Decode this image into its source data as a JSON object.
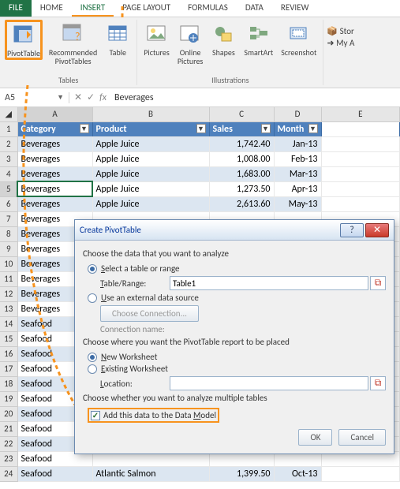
{
  "tabs": {
    "file": "FILE",
    "home": "HOME",
    "insert": "INSERT",
    "page_layout": "PAGE LAYOUT",
    "formulas": "FORMULAS",
    "data": "DATA",
    "review": "REVIEW"
  },
  "ribbon": {
    "pivottable": "PivotTable",
    "recommended": "Recommended\nPivotTables",
    "table": "Table",
    "pictures": "Pictures",
    "online_pictures": "Online\nPictures",
    "shapes": "Shapes",
    "smartart": "SmartArt",
    "screenshot": "Screenshot",
    "group_tables": "Tables",
    "group_illustrations": "Illustrations"
  },
  "account": {
    "stor": "Stor",
    "my": "My A"
  },
  "formula_bar": {
    "name_box": "A5",
    "fx_value": "Beverages"
  },
  "columns": [
    "A",
    "B",
    "C",
    "D",
    "E"
  ],
  "table_headers": {
    "category": "Category",
    "product": "Product",
    "sales": "Sales",
    "month": "Month"
  },
  "rows": [
    {
      "n": 2,
      "cat": "Beverages",
      "prod": "Apple Juice",
      "sales": "1,742.40",
      "month": "Jan-13"
    },
    {
      "n": 3,
      "cat": "Beverages",
      "prod": "Apple Juice",
      "sales": "1,008.00",
      "month": "Feb-13"
    },
    {
      "n": 4,
      "cat": "Beverages",
      "prod": "Apple Juice",
      "sales": "1,683.00",
      "month": "Mar-13"
    },
    {
      "n": 5,
      "cat": "Beverages",
      "prod": "Apple Juice",
      "sales": "1,273.50",
      "month": "Apr-13"
    },
    {
      "n": 6,
      "cat": "Beverages",
      "prod": "Apple Juice",
      "sales": "2,613.60",
      "month": "May-13"
    },
    {
      "n": 7,
      "cat": "Beverages",
      "prod": "",
      "sales": "",
      "month": ""
    },
    {
      "n": 8,
      "cat": "Beverages",
      "prod": "",
      "sales": "",
      "month": ""
    },
    {
      "n": 9,
      "cat": "Beverages",
      "prod": "",
      "sales": "",
      "month": ""
    },
    {
      "n": 10,
      "cat": "Beverages",
      "prod": "",
      "sales": "",
      "month": ""
    },
    {
      "n": 11,
      "cat": "Beverages",
      "prod": "",
      "sales": "",
      "month": ""
    },
    {
      "n": 12,
      "cat": "Beverages",
      "prod": "",
      "sales": "",
      "month": ""
    },
    {
      "n": 13,
      "cat": "Beverages",
      "prod": "",
      "sales": "",
      "month": ""
    },
    {
      "n": 14,
      "cat": "Seafood",
      "prod": "",
      "sales": "",
      "month": ""
    },
    {
      "n": 15,
      "cat": "Seafood",
      "prod": "",
      "sales": "",
      "month": ""
    },
    {
      "n": 16,
      "cat": "Seafood",
      "prod": "",
      "sales": "",
      "month": ""
    },
    {
      "n": 17,
      "cat": "Seafood",
      "prod": "",
      "sales": "",
      "month": ""
    },
    {
      "n": 18,
      "cat": "Seafood",
      "prod": "",
      "sales": "",
      "month": ""
    },
    {
      "n": 19,
      "cat": "Seafood",
      "prod": "",
      "sales": "",
      "month": ""
    },
    {
      "n": 20,
      "cat": "Seafood",
      "prod": "",
      "sales": "",
      "month": ""
    },
    {
      "n": 21,
      "cat": "Seafood",
      "prod": "",
      "sales": "",
      "month": ""
    },
    {
      "n": 22,
      "cat": "Seafood",
      "prod": "",
      "sales": "",
      "month": ""
    },
    {
      "n": 23,
      "cat": "Seafood",
      "prod": "",
      "sales": "",
      "month": ""
    },
    {
      "n": 24,
      "cat": "Seafood",
      "prod": "Atlantic Salmon",
      "sales": "1,399.50",
      "month": "Oct-13"
    }
  ],
  "dialog": {
    "title": "Create PivotTable",
    "section1": "Choose the data that you want to analyze",
    "opt_select": "Select a table or range",
    "table_range_label": "Table/Range:",
    "table_range_value": "Table1",
    "opt_external": "Use an external data source",
    "choose_connection": "Choose Connection...",
    "connection_name": "Connection name:",
    "section2": "Choose where you want the PivotTable report to be placed",
    "opt_new": "New Worksheet",
    "opt_existing": "Existing Worksheet",
    "location_label": "Location:",
    "section3": "Choose whether you want to analyze multiple tables",
    "add_data_model": "Add this data to the Data Model",
    "ok": "OK",
    "cancel": "Cancel"
  }
}
